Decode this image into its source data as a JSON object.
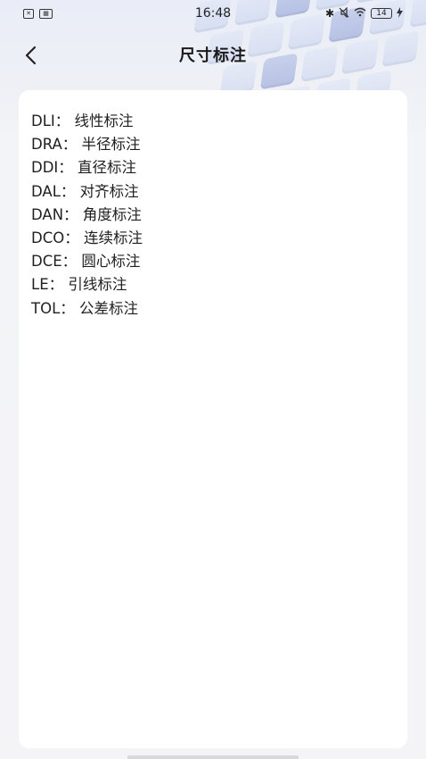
{
  "status_bar": {
    "time": "16:48",
    "left_icons": [
      "x-box-icon",
      "sim-icon"
    ],
    "battery_level": "14",
    "right_icons": [
      "bluetooth-icon",
      "mute-icon",
      "wifi-icon",
      "battery-icon",
      "charging-icon"
    ]
  },
  "header": {
    "title": "尺寸标注",
    "back_icon": "chevron-left-icon"
  },
  "items": [
    {
      "label": "DLI：  线性标注"
    },
    {
      "label": "DRA：  半径标注"
    },
    {
      "label": "DDI：  直径标注"
    },
    {
      "label": "DAL：  对齐标注"
    },
    {
      "label": "DAN：  角度标注"
    },
    {
      "label": "DCO：  连续标注"
    },
    {
      "label": "DCE：  圆心标注"
    },
    {
      "label": "LE：  引线标注"
    },
    {
      "label": "TOL：  公差标注"
    }
  ]
}
